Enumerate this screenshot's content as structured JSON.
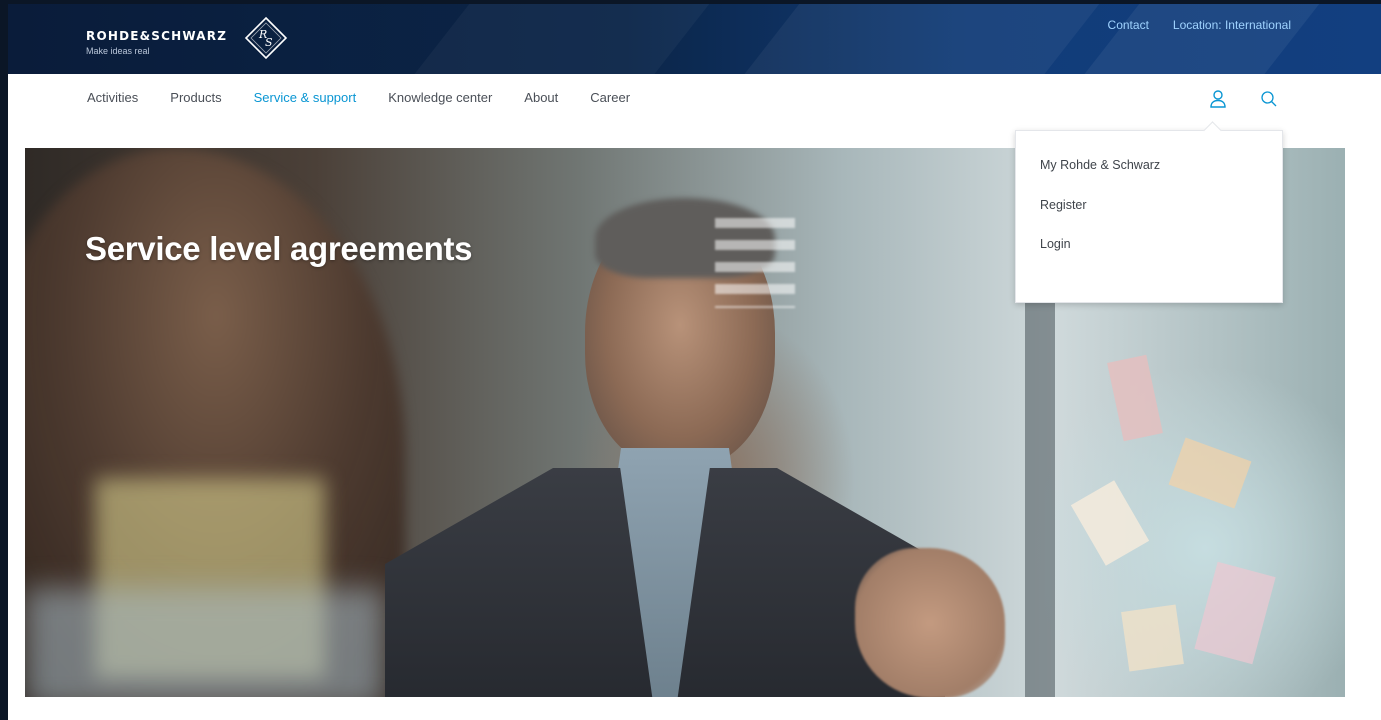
{
  "header": {
    "brand_name": "ROHDE&SCHWARZ",
    "tagline": "Make ideas real",
    "logo_letters": "R&S",
    "links": [
      {
        "label": "Contact"
      },
      {
        "label": "Location: International"
      }
    ]
  },
  "nav": {
    "items": [
      {
        "label": "Activities"
      },
      {
        "label": "Products"
      },
      {
        "label": "Service & support",
        "active": true
      },
      {
        "label": "Knowledge center"
      },
      {
        "label": "About"
      },
      {
        "label": "Career"
      }
    ],
    "icons": [
      "user-icon",
      "search-icon"
    ]
  },
  "hero": {
    "title": "Service level agreements"
  },
  "user_menu": {
    "items": [
      {
        "label": "My Rohde & Schwarz"
      },
      {
        "label": "Register"
      },
      {
        "label": "Login"
      }
    ]
  },
  "colors": {
    "header_dark": "#0a1c3a",
    "header_light": "#123f80",
    "accent": "#0a96d3",
    "link": "#9fd3ff"
  }
}
